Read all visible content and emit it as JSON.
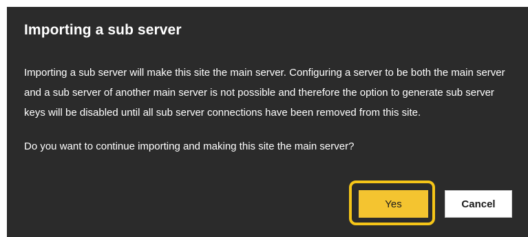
{
  "dialog": {
    "title": "Importing a sub server",
    "message": "Importing a sub server will make this site the main server. Configuring a server to be both the main server and a sub server of another main server is not possible and therefore the option to generate sub server keys will be disabled until all sub server connections have been removed from this site.",
    "question": "Do you want to continue importing and making this site the main server?",
    "yes_label": "Yes",
    "cancel_label": "Cancel"
  },
  "colors": {
    "dialog_background": "#2b2b2b",
    "accent": "#f4c430",
    "highlight_ring": "#f5c518"
  }
}
